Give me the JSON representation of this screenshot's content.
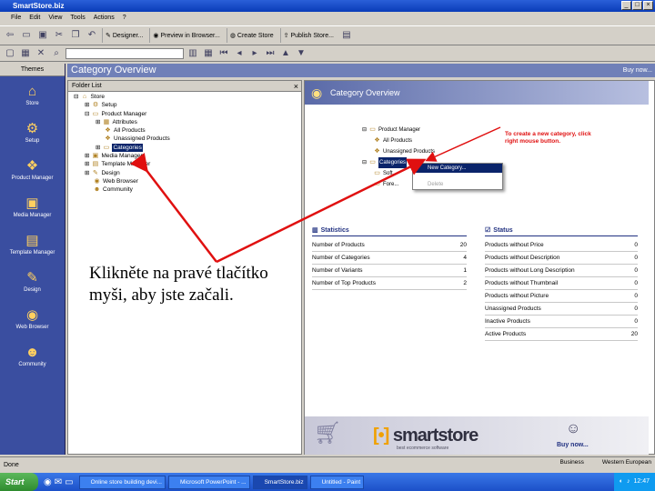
{
  "window": {
    "title": "SmartStore.biz"
  },
  "menu": [
    "File",
    "Edit",
    "View",
    "Tools",
    "Actions",
    "?"
  ],
  "toolbar": {
    "designer": "Designer...",
    "preview": "Preview in Browser...",
    "create_store": "Create Store",
    "publish_store": "Publish Store..."
  },
  "nav": {
    "header": "Themes",
    "items": [
      "Store",
      "Setup",
      "Product Manager",
      "Media Manager",
      "Template Manager",
      "Design",
      "Web Browser",
      "Community"
    ]
  },
  "main": {
    "title": "Category Overview",
    "buy_now": "Buy now..."
  },
  "folder_list": {
    "title": "Folder List",
    "items": [
      "Store",
      "Setup",
      "Product Manager",
      "Attributes",
      "All Products",
      "Unassigned Products",
      "Categories",
      "Media Manager",
      "Template Manager",
      "Design",
      "Web Browser",
      "Community"
    ]
  },
  "caption": "Klikněte na pravé tlačítko myši, aby jste začali.",
  "overview": {
    "title": "Category Overview",
    "tree": [
      "Product Manager",
      "All Products",
      "Unassigned Products",
      "Categories",
      "Soft...",
      "Fore..."
    ],
    "context_menu": [
      "New Category...",
      "Delete"
    ],
    "hint": "To create a new category, click right mouse button."
  },
  "statistics": {
    "title": "Statistics",
    "rows": [
      {
        "label": "Number of Products",
        "value": "20"
      },
      {
        "label": "Number of Categories",
        "value": "4"
      },
      {
        "label": "Number of Variants",
        "value": "1"
      },
      {
        "label": "Number of Top Products",
        "value": "2"
      }
    ]
  },
  "status": {
    "title": "Status",
    "rows": [
      {
        "label": "Products without Price",
        "value": "0"
      },
      {
        "label": "Products without Description",
        "value": "0"
      },
      {
        "label": "Products without Long Description",
        "value": "0"
      },
      {
        "label": "Products without Thumbnail",
        "value": "0"
      },
      {
        "label": "Products without Picture",
        "value": "0"
      },
      {
        "label": "Unassigned Products",
        "value": "0"
      },
      {
        "label": "Inactive Products",
        "value": "0"
      },
      {
        "label": "Active Products",
        "value": "20"
      }
    ]
  },
  "banner": {
    "logo_a": "smart",
    "logo_b": "store",
    "tagline": "best ecommerce software",
    "buy_now": "Buy now..."
  },
  "statusbar": {
    "left": "Done",
    "business": "Business",
    "region": "Western European"
  },
  "taskbar": {
    "start": "Start",
    "tasks": [
      "Online store building devi...",
      "Microsoft PowerPoint - ...",
      "SmartStore.biz",
      "Untitled - Paint"
    ],
    "clock": "12:47"
  },
  "colors": {
    "accent": "#0a246a",
    "arrow": "#e01010",
    "nav_bg": "#3a4ea0"
  }
}
